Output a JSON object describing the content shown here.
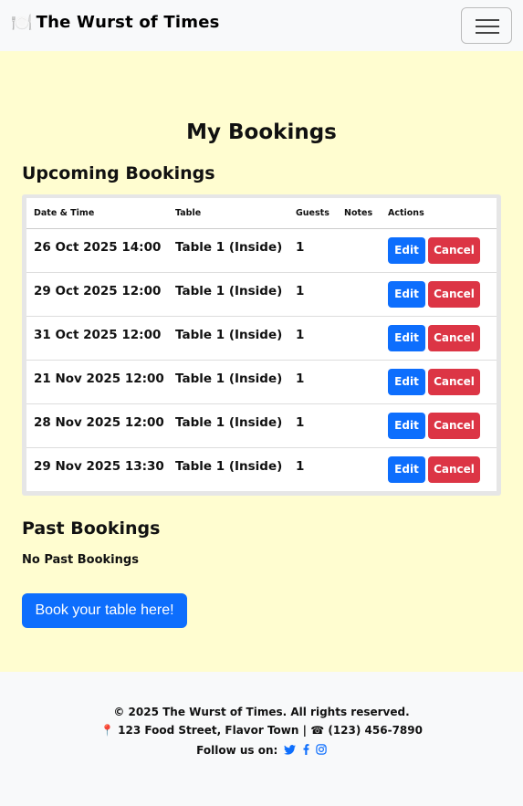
{
  "nav": {
    "brand_icon": "🍽️",
    "brand_text": "The Wurst of Times",
    "toggler_icon": "hamburger-menu-icon"
  },
  "main": {
    "title": "My Bookings",
    "upcoming_title": "Upcoming Bookings",
    "columns": [
      "Date & Time",
      "Table",
      "Guests",
      "Notes",
      "Actions"
    ],
    "rows": [
      {
        "datetime": "26 Oct 2025 14:00",
        "table": "Table 1 (Inside)",
        "guests": "1",
        "notes": ""
      },
      {
        "datetime": "29 Oct 2025 12:00",
        "table": "Table 1 (Inside)",
        "guests": "1",
        "notes": ""
      },
      {
        "datetime": "31 Oct 2025 12:00",
        "table": "Table 1 (Inside)",
        "guests": "1",
        "notes": ""
      },
      {
        "datetime": "21 Nov 2025 12:00",
        "table": "Table 1 (Inside)",
        "guests": "1",
        "notes": ""
      },
      {
        "datetime": "28 Nov 2025 12:00",
        "table": "Table 1 (Inside)",
        "guests": "1",
        "notes": ""
      },
      {
        "datetime": "29 Nov 2025 13:30",
        "table": "Table 1 (Inside)",
        "guests": "1",
        "notes": ""
      }
    ],
    "edit_label": "Edit",
    "cancel_label": "Cancel",
    "past_title": "Past Bookings",
    "no_past": "No Past Bookings",
    "book_button": "Book your table here!"
  },
  "footer": {
    "copyright": "© 2025 The Wurst of Times. All rights reserved.",
    "pin_icon": "📍",
    "address": "123 Food Street, Flavor Town",
    "separator": "|",
    "phone_icon": "☎",
    "phone": "(123) 456-7890",
    "follow": "Follow us on:"
  },
  "colors": {
    "background": "#fffdd0",
    "primary": "#0d6efd",
    "danger": "#dc3545",
    "navbar": "#f8f9fa"
  }
}
